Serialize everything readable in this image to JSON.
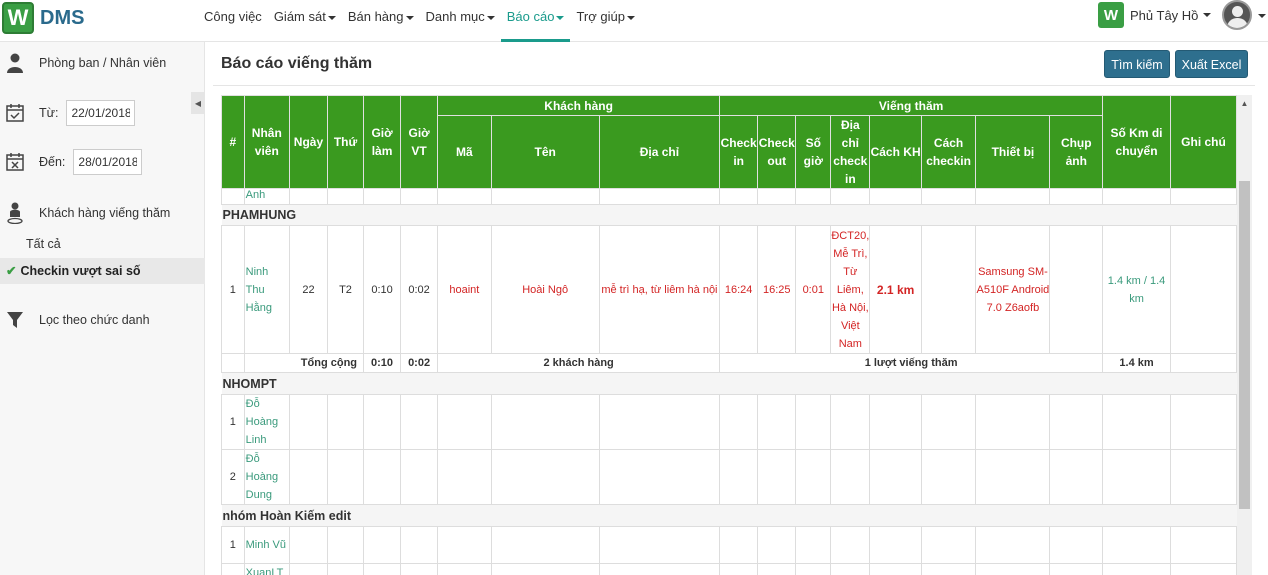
{
  "app": {
    "logo_letter": "W",
    "name": "DMS"
  },
  "nav": [
    {
      "label": "Công việc",
      "dropdown": false
    },
    {
      "label": "Giám sát",
      "dropdown": true
    },
    {
      "label": "Bán hàng",
      "dropdown": true
    },
    {
      "label": "Danh mục",
      "dropdown": true
    },
    {
      "label": "Báo cáo",
      "dropdown": true,
      "active": true
    },
    {
      "label": "Trợ giúp",
      "dropdown": true
    }
  ],
  "user": {
    "logo_letter": "W",
    "name": "Phủ Tây Hồ"
  },
  "sidebar": {
    "staff_label": "Phòng ban / Nhân viên",
    "from_label": "Từ:",
    "from_value": "22/01/2018",
    "to_label": "Đến:",
    "to_value": "28/01/2018",
    "customer_label": "Khách hàng viếng thăm",
    "all_label": "Tất cả",
    "checkin_label": "Checkin vượt sai số",
    "filter_label": "Lọc theo chức danh"
  },
  "page": {
    "title": "Báo cáo viếng thăm",
    "search_button": "Tìm kiếm",
    "export_button": "Xuất Excel"
  },
  "table": {
    "headers": {
      "index": "#",
      "staff": "Nhân viên",
      "day": "Ngày",
      "weekday": "Thứ",
      "work_hours": "Giờ làm",
      "vt_hours": "Giờ VT",
      "customer_group": "Khách hàng",
      "code": "Mã",
      "name": "Tên",
      "address": "Địa chỉ",
      "visit_group": "Viếng thăm",
      "checkin": "Check in",
      "checkout": "Check out",
      "hours": "Số giờ",
      "checkin_address": "Địa chỉ check in",
      "distance_kh": "Cách KH",
      "distance_checkin": "Cách checkin",
      "device": "Thiết bị",
      "photo": "Chụp ảnh",
      "km": "Số Km di chuyển",
      "note": "Ghi chú"
    },
    "partial_row_name": "Anh",
    "groups": [
      {
        "name": "PHAMHUNG",
        "rows": [
          {
            "index": "1",
            "staff": "Ninh Thu Hằng",
            "day": "22",
            "weekday": "T2",
            "work_hours": "0:10",
            "vt_hours": "0:02",
            "code": "hoaint",
            "name": "Hoài Ngô",
            "address": "mễ trì hạ, từ liêm hà nội",
            "checkin": "16:24",
            "checkout": "16:25",
            "hours": "0:01",
            "checkin_address": "ĐCT20, Mễ Trì, Từ Liêm, Hà Nội, Việt Nam",
            "distance_kh": "2.1 km",
            "distance_checkin": "",
            "device": "Samsung SM-A510F Android 7.0 Z6aofb",
            "photo": "",
            "km": "1.4 km / 1.4 km",
            "note": ""
          }
        ],
        "total": {
          "label": "Tổng cộng",
          "work_hours": "0:10",
          "vt_hours": "0:02",
          "customers": "2 khách hàng",
          "visits": "1 lượt viếng thăm",
          "km": "1.4 km"
        }
      },
      {
        "name": "NHOMPT",
        "rows": [
          {
            "index": "1",
            "staff": "Đỗ Hoàng Linh"
          },
          {
            "index": "2",
            "staff": "Đỗ Hoàng Dung"
          }
        ]
      },
      {
        "name": "nhóm Hoàn Kiếm edit",
        "rows": [
          {
            "index": "1",
            "staff": "Minh Vũ"
          },
          {
            "index": "",
            "staff": "XuanLT"
          }
        ]
      }
    ]
  }
}
